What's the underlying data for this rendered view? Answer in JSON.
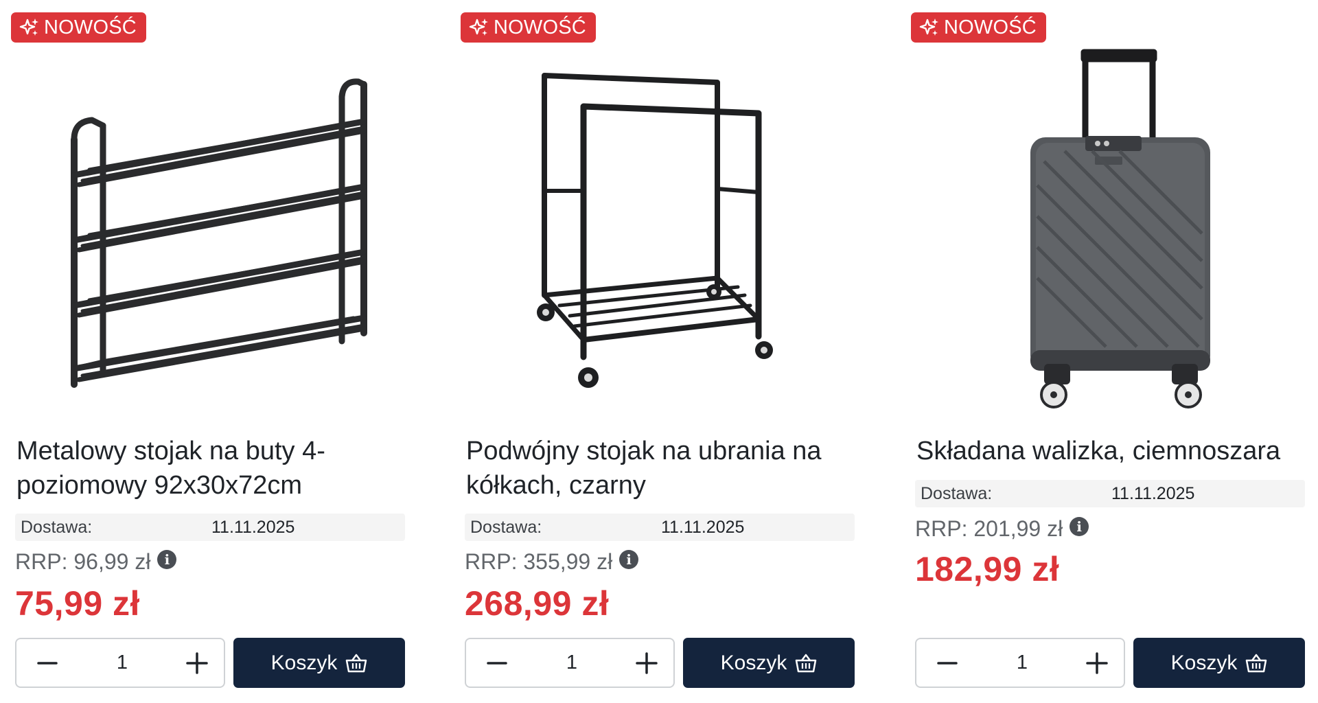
{
  "colors": {
    "badge": "#dc3539",
    "price": "#dc3539",
    "cart_button": "#14243d",
    "delivery_bg": "#f4f4f4"
  },
  "products": [
    {
      "badge": "NOWOŚĆ",
      "badge_icon": "sparkle-icon",
      "image": "shoe-rack-image",
      "title": "Metalowy stojak na buty 4-poziomowy 92x30x72cm",
      "delivery_label": "Dostawa:",
      "delivery_date": "11.11.2025",
      "rrp": "RRP: 96,99 zł",
      "price": "75,99 zł",
      "quantity": "1",
      "cart_label": "Koszyk"
    },
    {
      "badge": "NOWOŚĆ",
      "badge_icon": "sparkle-icon",
      "image": "clothes-rack-image",
      "title": "Podwójny stojak na ubrania na kółkach, czarny",
      "delivery_label": "Dostawa:",
      "delivery_date": "11.11.2025",
      "rrp": "RRP: 355,99 zł",
      "price": "268,99 zł",
      "quantity": "1",
      "cart_label": "Koszyk"
    },
    {
      "badge": "NOWOŚĆ",
      "badge_icon": "sparkle-icon",
      "image": "suitcase-image",
      "title": "Składana walizka, ciemnoszara",
      "delivery_label": "Dostawa:",
      "delivery_date": "11.11.2025",
      "rrp": "RRP: 201,99 zł",
      "price": "182,99 zł",
      "quantity": "1",
      "cart_label": "Koszyk"
    }
  ]
}
